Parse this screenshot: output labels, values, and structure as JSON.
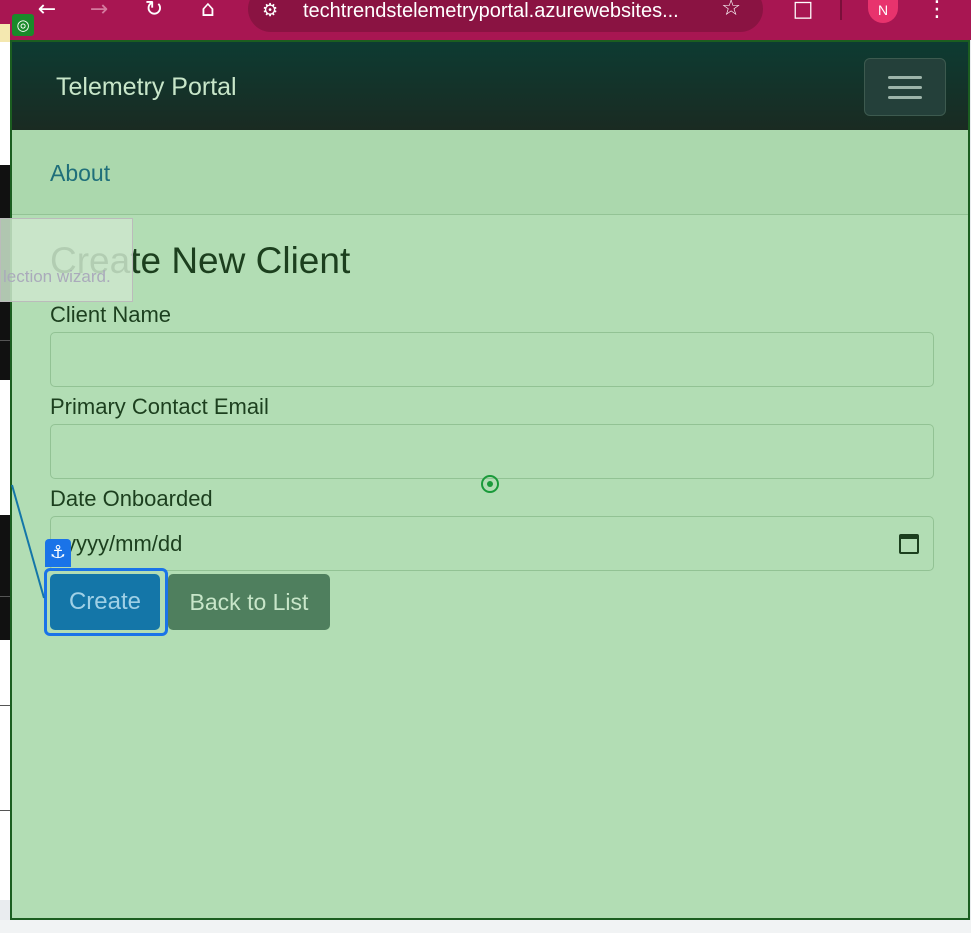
{
  "browser": {
    "url": "techtrendstelemetryportal.azurewebsites...",
    "profile_initial": "N",
    "icons": [
      "back-icon",
      "forward-icon",
      "reload-icon",
      "home-icon",
      "site-info-icon",
      "star-icon",
      "extensions-icon",
      "menu-icon"
    ]
  },
  "navbar": {
    "brand": "Telemetry Portal",
    "menu": [
      "About"
    ]
  },
  "page": {
    "title": "Create New Client",
    "fields": {
      "client_name": {
        "label": "Client Name",
        "value": ""
      },
      "email": {
        "label": "Primary Contact Email",
        "value": ""
      },
      "date": {
        "label": "Date Onboarded",
        "placeholder": "yyyy/mm/dd"
      }
    },
    "buttons": {
      "create": "Create",
      "back": "Back to List"
    }
  },
  "overlay": {
    "tooltip_text": "lection wizard."
  },
  "colors": {
    "chrome": "#a81652",
    "navbar": "#0d3b32",
    "page_bg": "#b2ddb4",
    "primary": "#1476a8",
    "secondary": "#4f7f5e"
  }
}
